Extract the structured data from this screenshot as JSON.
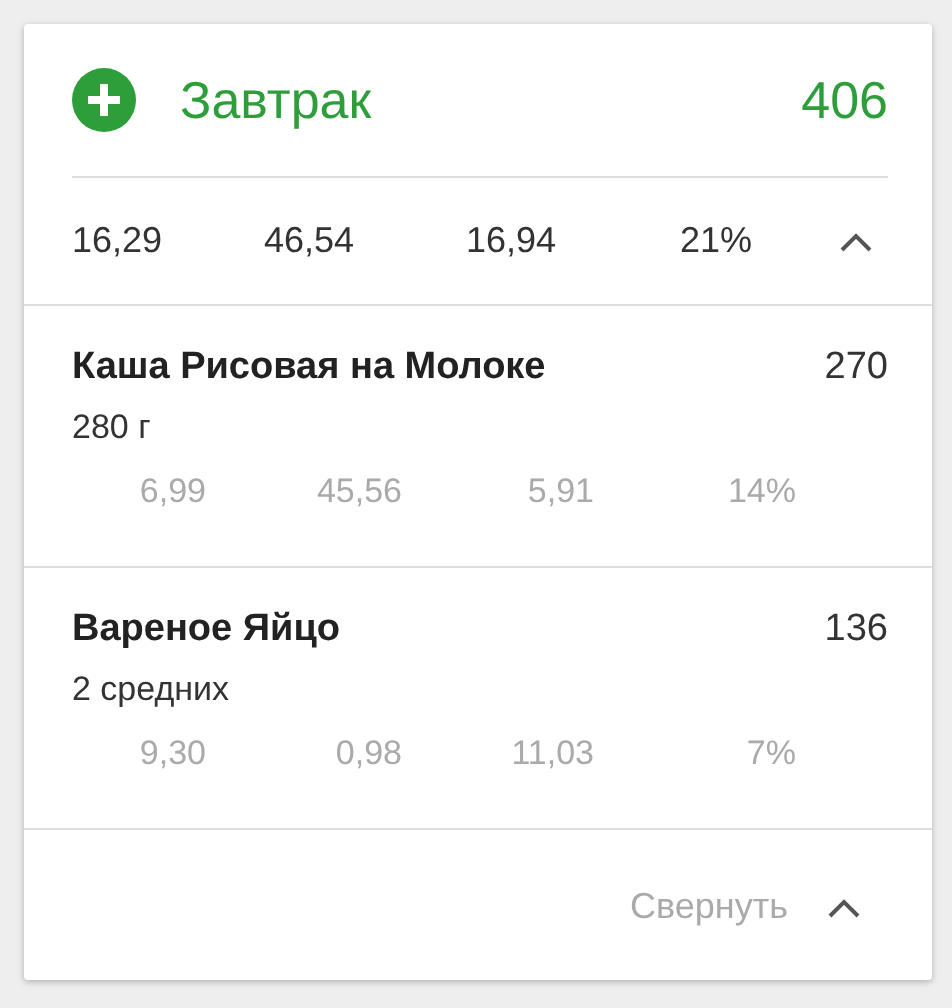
{
  "meal": {
    "title": "Завтрак",
    "calories": "406",
    "expanded": true
  },
  "summary": [
    "16,29",
    "46,54",
    "16,94",
    "21%"
  ],
  "foods": [
    {
      "name": "Каша Рисовая на Молоке",
      "calories": "270",
      "amount": "280  г",
      "macros": [
        "6,99",
        "45,56",
        "5,91",
        "14%"
      ]
    },
    {
      "name": "Вареное Яйцо",
      "calories": "136",
      "amount": "2  средних",
      "macros": [
        "9,30",
        "0,98",
        "11,03",
        "7%"
      ]
    }
  ],
  "collapse_label": "Свернуть"
}
